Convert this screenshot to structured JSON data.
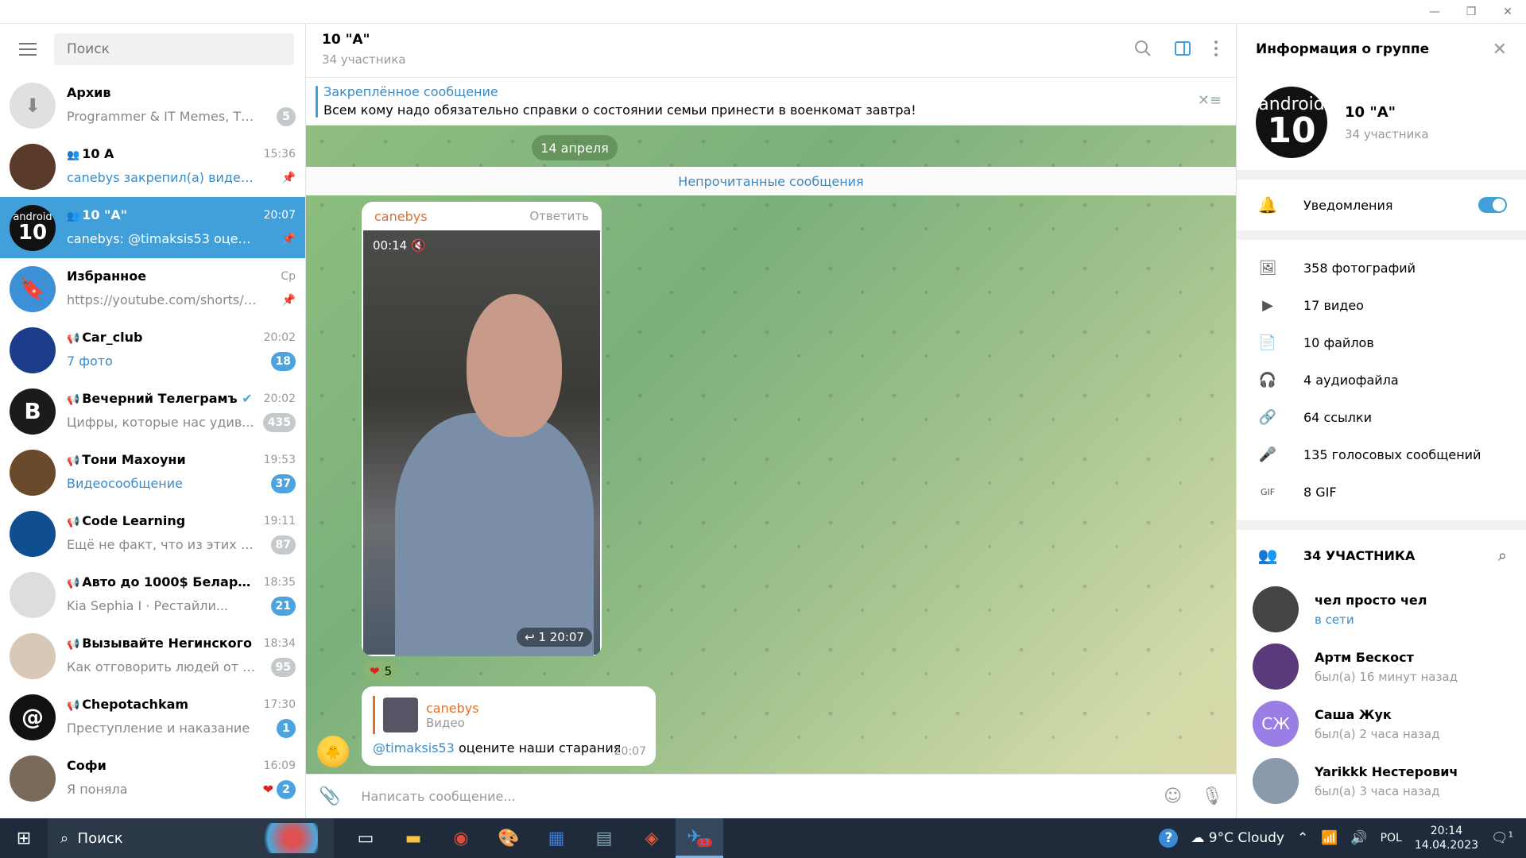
{
  "window": {
    "minimize": "—",
    "restore": "❐",
    "close": "✕"
  },
  "sidebar": {
    "search_placeholder": "Поиск",
    "chats": [
      {
        "name": "Архив",
        "time": "",
        "msg": "Programmer & IT Memes, ТикТ...",
        "badge": "5",
        "badge_style": "grey",
        "pinned": false,
        "avatar": "archive-icon",
        "color": "#e0e0e0"
      },
      {
        "name": "10 А",
        "time": "15:36",
        "msg": "canebys закрепил(а) видеосоо...",
        "badge": "",
        "pinned": true,
        "avatar": "photo",
        "color": "#5a3a2a",
        "kind": "group"
      },
      {
        "name": "10 \"A\"",
        "time": "20:07",
        "msg": "canebys: @timaksis53 оцените ...",
        "badge": "",
        "pinned": true,
        "avatar": "android",
        "color": "#111111",
        "kind": "group",
        "active": true
      },
      {
        "name": "Избранное",
        "time": "Ср",
        "msg": "https://youtube.com/shorts/JrfD...",
        "badge": "",
        "pinned": true,
        "avatar": "bookmark-icon",
        "color": "#3d8fd6"
      },
      {
        "name": "Car_club",
        "time": "20:02",
        "msg": "7 фото",
        "badge": "18",
        "avatar": "photo",
        "color": "#1a3c8a",
        "kind": "channel"
      },
      {
        "name": "Вечерний Телеграмъ",
        "time": "20:02",
        "msg": "Цифры, которые нас удив...",
        "badge": "435",
        "badge_style": "grey",
        "avatar": "letter",
        "letter": "B",
        "color": "#1b1b1b",
        "kind": "channel",
        "verified": true
      },
      {
        "name": "Тони Махоуни",
        "time": "19:53",
        "msg": "Видеосообщение",
        "badge": "37",
        "avatar": "photo",
        "color": "#6a4a2a",
        "kind": "channel"
      },
      {
        "name": "Code Learning",
        "time": "19:11",
        "msg": "Ещё не факт, что из этих се...",
        "badge": "87",
        "badge_style": "grey",
        "avatar": "photo",
        "color": "#0f4f8f",
        "kind": "channel"
      },
      {
        "name": "Авто до 1000$ Беларусь...",
        "time": "18:35",
        "msg": "Kia Sephia I · Рестайли...",
        "badge": "21",
        "avatar": "photo",
        "color": "#dddddd",
        "kind": "channel"
      },
      {
        "name": "Вызывайте Негинского",
        "time": "18:34",
        "msg": "Как отговорить людей от V...",
        "badge": "95",
        "badge_style": "grey",
        "avatar": "photo",
        "color": "#d8c8b8",
        "kind": "channel"
      },
      {
        "name": "Chepotachkam",
        "time": "17:30",
        "msg": "Преступление и наказание",
        "badge": "1",
        "avatar": "letter",
        "letter": "@",
        "color": "#111111",
        "kind": "channel"
      },
      {
        "name": "Софи",
        "time": "16:09",
        "msg": "Я поняла",
        "badge": "2",
        "avatar": "photo",
        "color": "#7a6a5a",
        "heart": true
      }
    ]
  },
  "chat": {
    "title": "10 \"A\"",
    "subtitle": "34 участника",
    "pinned_label": "Закреплённое сообщение",
    "pinned_text": "Всем кому надо обязательно справки о состоянии семьи принести в военкомат завтра!",
    "date_chip": "14 апреля",
    "unread_label": "Непрочитанные сообщения",
    "message1": {
      "sender": "canebys",
      "reply": "Ответить",
      "video_time": "00:14",
      "replies": "1",
      "time": "20:07",
      "reactions": "5"
    },
    "message2": {
      "quote_name": "canebys",
      "quote_type": "Видео",
      "mention": "@timaksis53",
      "text": " оцените наши старания",
      "time": "20:07"
    },
    "compose_placeholder": "Написать сообщение..."
  },
  "info": {
    "title": "Информация о группе",
    "name": "10 \"A\"",
    "members": "34 участника",
    "avatar_top": "android",
    "avatar_num": "10",
    "notifications": "Уведомления",
    "media": [
      {
        "icon": "photo-icon",
        "label": "358 фотографий"
      },
      {
        "icon": "video-icon",
        "label": "17 видео"
      },
      {
        "icon": "file-icon",
        "label": "10 файлов"
      },
      {
        "icon": "headphones-icon",
        "label": "4 аудиофайла"
      },
      {
        "icon": "link-icon",
        "label": "64 ссылки"
      },
      {
        "icon": "mic-icon",
        "label": "135 голосовых сообщений"
      },
      {
        "icon": "gif-icon",
        "label": "8 GIF"
      }
    ],
    "members_header": "34 УЧАСТНИКА",
    "member_list": [
      {
        "name": "чел просто чел",
        "status": "в сети",
        "online": true,
        "color": "#444444"
      },
      {
        "name": "Артм Бескост",
        "status": "был(а) 16 минут назад",
        "online": false,
        "color": "#5a3a7a"
      },
      {
        "name": "Саша Жук",
        "status": "был(а) 2 часа назад",
        "online": false,
        "color": "#9b7de6",
        "initials": "СЖ"
      },
      {
        "name": "Yarikkk Нестерович",
        "status": "был(а) 3 часа назад",
        "online": false,
        "color": "#8a9aaa"
      }
    ]
  },
  "taskbar": {
    "search": "Поиск",
    "weather": "9°C  Cloudy",
    "lang": "POL",
    "time": "20:14",
    "date": "14.04.2023",
    "telegram_badge": "13",
    "notif_count": "1"
  }
}
